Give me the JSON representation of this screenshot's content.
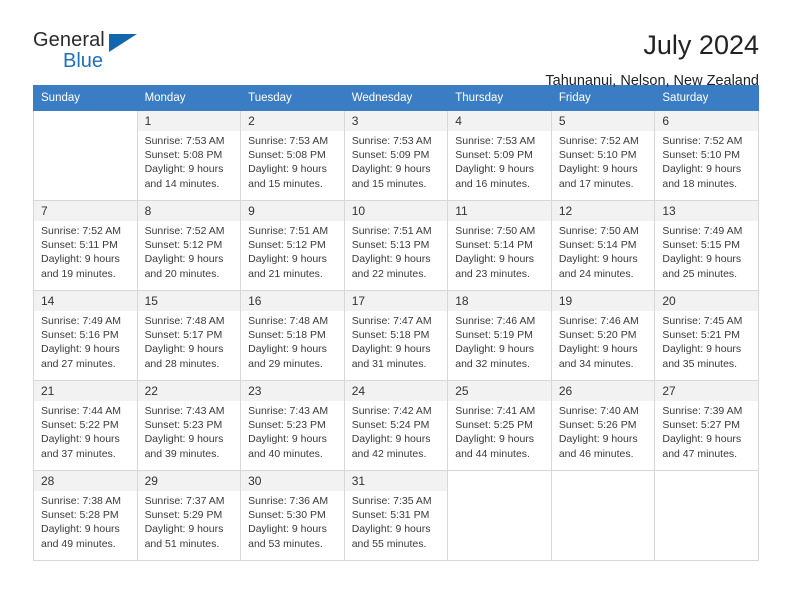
{
  "brand": {
    "name_top": "General",
    "name_bottom": "Blue",
    "triangle_color": "#1266ae",
    "blue_color": "#1f71bb"
  },
  "header": {
    "title": "July 2024",
    "subtitle": "Tahunanui, Nelson, New Zealand"
  },
  "theme": {
    "header_row_bg": "#3b7dc4",
    "header_row_text": "#ffffff",
    "daynum_bg": "#f2f2f2",
    "cell_border": "#d7d7d7"
  },
  "weekdays": [
    "Sunday",
    "Monday",
    "Tuesday",
    "Wednesday",
    "Thursday",
    "Friday",
    "Saturday"
  ],
  "weeks": [
    [
      {
        "day": ""
      },
      {
        "day": "1",
        "sunrise": "Sunrise: 7:53 AM",
        "sunset": "Sunset: 5:08 PM",
        "daylight1": "Daylight: 9 hours",
        "daylight2": "and 14 minutes."
      },
      {
        "day": "2",
        "sunrise": "Sunrise: 7:53 AM",
        "sunset": "Sunset: 5:08 PM",
        "daylight1": "Daylight: 9 hours",
        "daylight2": "and 15 minutes."
      },
      {
        "day": "3",
        "sunrise": "Sunrise: 7:53 AM",
        "sunset": "Sunset: 5:09 PM",
        "daylight1": "Daylight: 9 hours",
        "daylight2": "and 15 minutes."
      },
      {
        "day": "4",
        "sunrise": "Sunrise: 7:53 AM",
        "sunset": "Sunset: 5:09 PM",
        "daylight1": "Daylight: 9 hours",
        "daylight2": "and 16 minutes."
      },
      {
        "day": "5",
        "sunrise": "Sunrise: 7:52 AM",
        "sunset": "Sunset: 5:10 PM",
        "daylight1": "Daylight: 9 hours",
        "daylight2": "and 17 minutes."
      },
      {
        "day": "6",
        "sunrise": "Sunrise: 7:52 AM",
        "sunset": "Sunset: 5:10 PM",
        "daylight1": "Daylight: 9 hours",
        "daylight2": "and 18 minutes."
      }
    ],
    [
      {
        "day": "7",
        "sunrise": "Sunrise: 7:52 AM",
        "sunset": "Sunset: 5:11 PM",
        "daylight1": "Daylight: 9 hours",
        "daylight2": "and 19 minutes."
      },
      {
        "day": "8",
        "sunrise": "Sunrise: 7:52 AM",
        "sunset": "Sunset: 5:12 PM",
        "daylight1": "Daylight: 9 hours",
        "daylight2": "and 20 minutes."
      },
      {
        "day": "9",
        "sunrise": "Sunrise: 7:51 AM",
        "sunset": "Sunset: 5:12 PM",
        "daylight1": "Daylight: 9 hours",
        "daylight2": "and 21 minutes."
      },
      {
        "day": "10",
        "sunrise": "Sunrise: 7:51 AM",
        "sunset": "Sunset: 5:13 PM",
        "daylight1": "Daylight: 9 hours",
        "daylight2": "and 22 minutes."
      },
      {
        "day": "11",
        "sunrise": "Sunrise: 7:50 AM",
        "sunset": "Sunset: 5:14 PM",
        "daylight1": "Daylight: 9 hours",
        "daylight2": "and 23 minutes."
      },
      {
        "day": "12",
        "sunrise": "Sunrise: 7:50 AM",
        "sunset": "Sunset: 5:14 PM",
        "daylight1": "Daylight: 9 hours",
        "daylight2": "and 24 minutes."
      },
      {
        "day": "13",
        "sunrise": "Sunrise: 7:49 AM",
        "sunset": "Sunset: 5:15 PM",
        "daylight1": "Daylight: 9 hours",
        "daylight2": "and 25 minutes."
      }
    ],
    [
      {
        "day": "14",
        "sunrise": "Sunrise: 7:49 AM",
        "sunset": "Sunset: 5:16 PM",
        "daylight1": "Daylight: 9 hours",
        "daylight2": "and 27 minutes."
      },
      {
        "day": "15",
        "sunrise": "Sunrise: 7:48 AM",
        "sunset": "Sunset: 5:17 PM",
        "daylight1": "Daylight: 9 hours",
        "daylight2": "and 28 minutes."
      },
      {
        "day": "16",
        "sunrise": "Sunrise: 7:48 AM",
        "sunset": "Sunset: 5:18 PM",
        "daylight1": "Daylight: 9 hours",
        "daylight2": "and 29 minutes."
      },
      {
        "day": "17",
        "sunrise": "Sunrise: 7:47 AM",
        "sunset": "Sunset: 5:18 PM",
        "daylight1": "Daylight: 9 hours",
        "daylight2": "and 31 minutes."
      },
      {
        "day": "18",
        "sunrise": "Sunrise: 7:46 AM",
        "sunset": "Sunset: 5:19 PM",
        "daylight1": "Daylight: 9 hours",
        "daylight2": "and 32 minutes."
      },
      {
        "day": "19",
        "sunrise": "Sunrise: 7:46 AM",
        "sunset": "Sunset: 5:20 PM",
        "daylight1": "Daylight: 9 hours",
        "daylight2": "and 34 minutes."
      },
      {
        "day": "20",
        "sunrise": "Sunrise: 7:45 AM",
        "sunset": "Sunset: 5:21 PM",
        "daylight1": "Daylight: 9 hours",
        "daylight2": "and 35 minutes."
      }
    ],
    [
      {
        "day": "21",
        "sunrise": "Sunrise: 7:44 AM",
        "sunset": "Sunset: 5:22 PM",
        "daylight1": "Daylight: 9 hours",
        "daylight2": "and 37 minutes."
      },
      {
        "day": "22",
        "sunrise": "Sunrise: 7:43 AM",
        "sunset": "Sunset: 5:23 PM",
        "daylight1": "Daylight: 9 hours",
        "daylight2": "and 39 minutes."
      },
      {
        "day": "23",
        "sunrise": "Sunrise: 7:43 AM",
        "sunset": "Sunset: 5:23 PM",
        "daylight1": "Daylight: 9 hours",
        "daylight2": "and 40 minutes."
      },
      {
        "day": "24",
        "sunrise": "Sunrise: 7:42 AM",
        "sunset": "Sunset: 5:24 PM",
        "daylight1": "Daylight: 9 hours",
        "daylight2": "and 42 minutes."
      },
      {
        "day": "25",
        "sunrise": "Sunrise: 7:41 AM",
        "sunset": "Sunset: 5:25 PM",
        "daylight1": "Daylight: 9 hours",
        "daylight2": "and 44 minutes."
      },
      {
        "day": "26",
        "sunrise": "Sunrise: 7:40 AM",
        "sunset": "Sunset: 5:26 PM",
        "daylight1": "Daylight: 9 hours",
        "daylight2": "and 46 minutes."
      },
      {
        "day": "27",
        "sunrise": "Sunrise: 7:39 AM",
        "sunset": "Sunset: 5:27 PM",
        "daylight1": "Daylight: 9 hours",
        "daylight2": "and 47 minutes."
      }
    ],
    [
      {
        "day": "28",
        "sunrise": "Sunrise: 7:38 AM",
        "sunset": "Sunset: 5:28 PM",
        "daylight1": "Daylight: 9 hours",
        "daylight2": "and 49 minutes."
      },
      {
        "day": "29",
        "sunrise": "Sunrise: 7:37 AM",
        "sunset": "Sunset: 5:29 PM",
        "daylight1": "Daylight: 9 hours",
        "daylight2": "and 51 minutes."
      },
      {
        "day": "30",
        "sunrise": "Sunrise: 7:36 AM",
        "sunset": "Sunset: 5:30 PM",
        "daylight1": "Daylight: 9 hours",
        "daylight2": "and 53 minutes."
      },
      {
        "day": "31",
        "sunrise": "Sunrise: 7:35 AM",
        "sunset": "Sunset: 5:31 PM",
        "daylight1": "Daylight: 9 hours",
        "daylight2": "and 55 minutes."
      },
      {
        "day": ""
      },
      {
        "day": ""
      },
      {
        "day": ""
      }
    ]
  ]
}
